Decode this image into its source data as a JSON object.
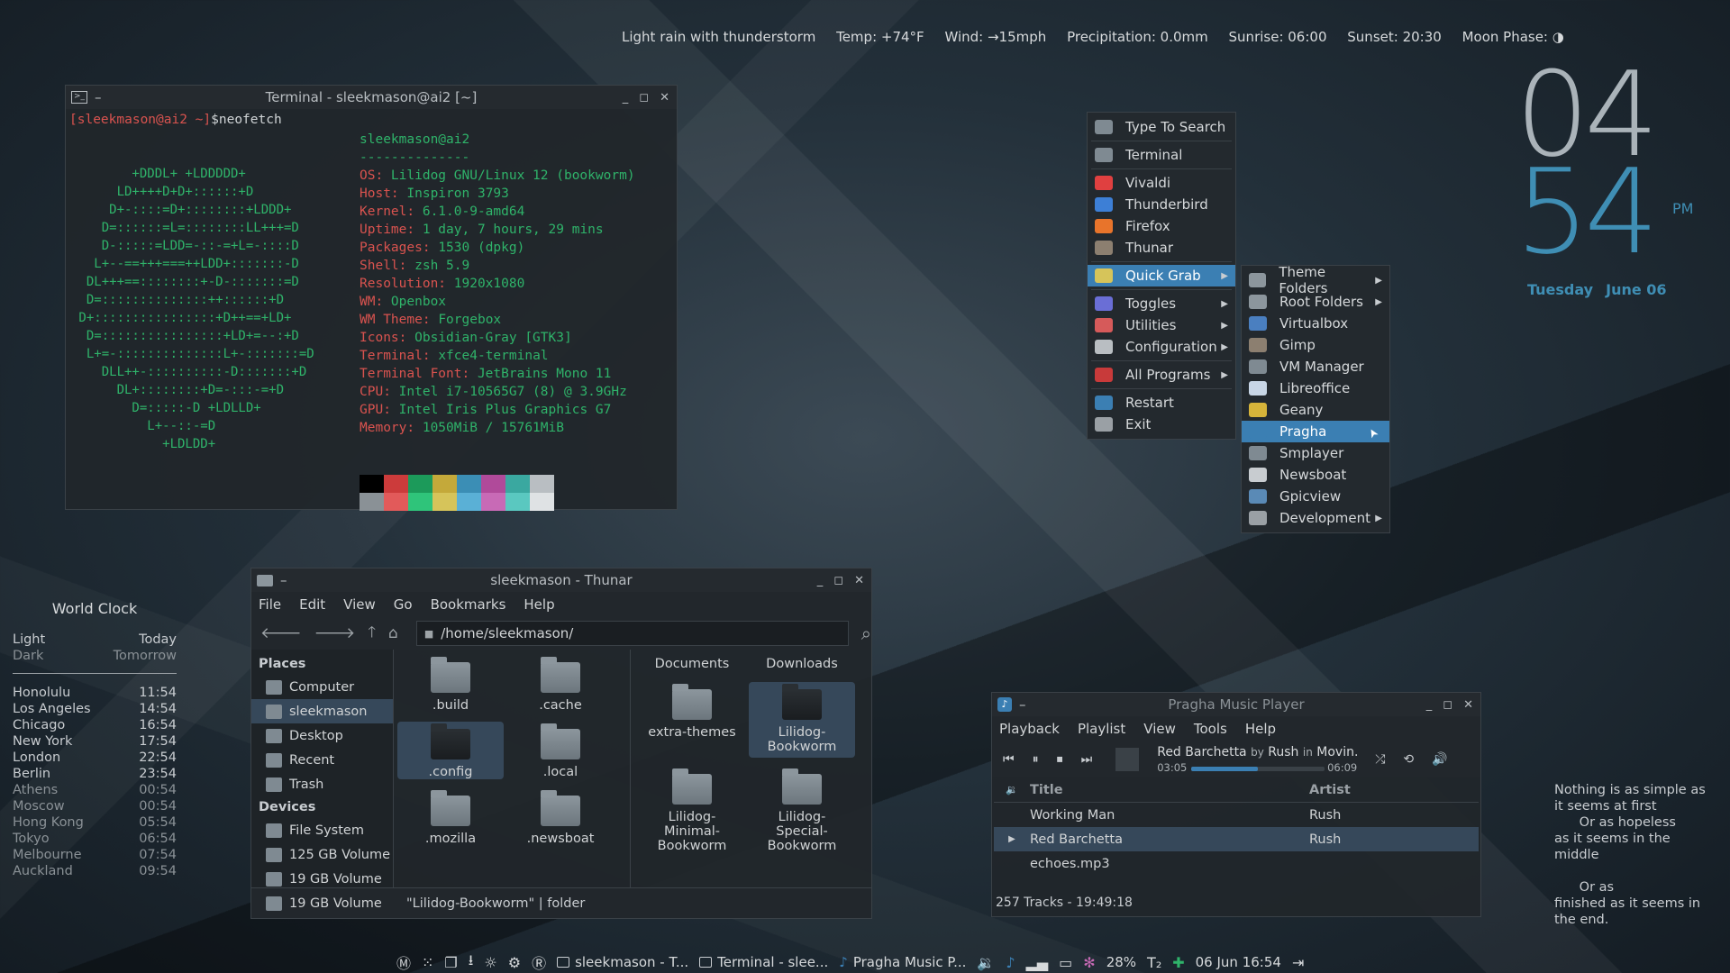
{
  "weather": {
    "condition": "Light rain with thunderstorm",
    "temp": "Temp: +74°F",
    "wind": "Wind: →15mph",
    "precip": "Precipitation: 0.0mm",
    "sunrise": "Sunrise: 06:00",
    "sunset": "Sunset: 20:30",
    "moon": "Moon Phase: ◑"
  },
  "clock": {
    "hour": "04",
    "minute": "54",
    "ampm": "PM",
    "day": "Tuesday",
    "date": "June 06"
  },
  "terminal": {
    "title": "Terminal - sleekmason@ai2 [~]",
    "prompt": "[sleekmason@ai2 ~]",
    "command": "$neofetch",
    "ascii": "        +DDDL+ +LDDDDD+\n      LD++++D+D+::::::+D\n     D+-::::=D+::::::::+LDDD+\n    D=::::::=L=::::::::LL+++=D\n    D-:::::=LDD=-::-=+L=-::::D\n   L+--==+++===++LDD+:::::::-D\n  DL+++==::::::::+-D-:::::::=D\n  D=::::::::::::::++::::::+D\n D+::::::::::::::::+D++==+LD+\n  D=::::::::::::::::+LD+=--:+D\n  L+=-::::::::::::::L+-:::::::=D\n    DLL++-::::::::::-D:::::::+D\n      DL+::::::::+D=-:::-=+D\n        D=:::::-D +LDLLD+\n          L+--::-=D\n            +LDLDD+",
    "header": "sleekmason@ai2",
    "dashes": "--------------",
    "info": [
      {
        "k": "OS: ",
        "v": "Lilidog GNU/Linux 12 (bookworm)"
      },
      {
        "k": "Host: ",
        "v": "Inspiron 3793"
      },
      {
        "k": "Kernel: ",
        "v": "6.1.0-9-amd64"
      },
      {
        "k": "Uptime: ",
        "v": "1 day, 7 hours, 29 mins"
      },
      {
        "k": "Packages: ",
        "v": "1530 (dpkg)"
      },
      {
        "k": "Shell: ",
        "v": "zsh 5.9"
      },
      {
        "k": "Resolution: ",
        "v": "1920x1080"
      },
      {
        "k": "WM: ",
        "v": "Openbox"
      },
      {
        "k": "WM Theme: ",
        "v": "Forgebox"
      },
      {
        "k": "Icons: ",
        "v": "Obsidian-Gray [GTK3]"
      },
      {
        "k": "Terminal: ",
        "v": "xfce4-terminal"
      },
      {
        "k": "Terminal Font: ",
        "v": "JetBrains Mono 11"
      },
      {
        "k": "CPU: ",
        "v": "Intel i7-10565G7 (8) @ 3.9GHz"
      },
      {
        "k": "GPU: ",
        "v": "Intel Iris Plus Graphics G7"
      },
      {
        "k": "Memory: ",
        "v": "1050MiB / 15761MiB"
      }
    ],
    "palette": [
      "#000000",
      "#cc3b3b",
      "#1c9a5a",
      "#c4a93a",
      "#3b8eb5",
      "#b04a9a",
      "#3aa8a0",
      "#b9bec2",
      "#8a9196",
      "#e25a5a",
      "#2fc47a",
      "#d6c45a",
      "#5ab0d6",
      "#c86ab6",
      "#5ac8c0",
      "#dfe2e4"
    ]
  },
  "main_menu": [
    {
      "label": "Type To Search",
      "icon": "keyboard-icon",
      "color": "#7f8a92"
    },
    {
      "sep": true
    },
    {
      "label": "Terminal",
      "icon": "terminal-icon",
      "color": "#7f8a92"
    },
    {
      "sep": true
    },
    {
      "label": "Vivaldi",
      "icon": "vivaldi-icon",
      "color": "#e04040"
    },
    {
      "label": "Thunderbird",
      "icon": "thunderbird-icon",
      "color": "#3d7fd6"
    },
    {
      "label": "Firefox",
      "icon": "firefox-icon",
      "color": "#e8742b"
    },
    {
      "label": "Thunar",
      "icon": "thunar-icon",
      "color": "#8c7f70"
    },
    {
      "sep": true
    },
    {
      "label": "Quick Grab",
      "icon": "quick-grab-icon",
      "color": "#d6c45a",
      "submenu": true,
      "selected": true
    },
    {
      "sep": true
    },
    {
      "label": "Toggles",
      "icon": "toggles-icon",
      "color": "#6a6ed6",
      "submenu": true
    },
    {
      "label": "Utilities",
      "icon": "utilities-icon",
      "color": "#d65a5a",
      "submenu": true
    },
    {
      "label": "Configuration",
      "icon": "configuration-icon",
      "color": "#b9bec2",
      "submenu": true
    },
    {
      "sep": true
    },
    {
      "label": "All Programs",
      "icon": "all-programs-icon",
      "color": "#c83a3a",
      "submenu": true
    },
    {
      "sep": true
    },
    {
      "label": "Restart",
      "icon": "restart-icon",
      "color": "#3b7fb3"
    },
    {
      "label": "Exit",
      "icon": "exit-icon",
      "color": "#9aa0a5"
    }
  ],
  "sub_menu": [
    {
      "label": "Theme Folders",
      "icon": "folder-icon",
      "color": "#8c969d",
      "submenu": true
    },
    {
      "label": "Root Folders",
      "icon": "folder-icon",
      "color": "#8c969d",
      "submenu": true
    },
    {
      "label": "Virtualbox",
      "icon": "virtualbox-icon",
      "color": "#4a7fc0"
    },
    {
      "label": "Gimp",
      "icon": "gimp-icon",
      "color": "#8c7f70"
    },
    {
      "label": "VM Manager",
      "icon": "vm-manager-icon",
      "color": "#7f8a92"
    },
    {
      "label": "Libreoffice",
      "icon": "libreoffice-icon",
      "color": "#c8d6e6"
    },
    {
      "label": "Geany",
      "icon": "geany-icon",
      "color": "#d6b43a"
    },
    {
      "label": "Pragha",
      "icon": "pragha-icon",
      "color": "#3b7fb3",
      "selected": true
    },
    {
      "label": "Smplayer",
      "icon": "smplayer-icon",
      "color": "#7f8a92"
    },
    {
      "label": "Newsboat",
      "icon": "newsboat-icon",
      "color": "#c8ccd0"
    },
    {
      "label": "Gpicview",
      "icon": "gpicview-icon",
      "color": "#5a8ab6"
    },
    {
      "label": "Development",
      "icon": "development-icon",
      "color": "#9aa0a5",
      "submenu": true
    }
  ],
  "thunar": {
    "title": "sleekmason - Thunar",
    "menus": [
      "File",
      "Edit",
      "View",
      "Go",
      "Bookmarks",
      "Help"
    ],
    "path": "/home/sleekmason/",
    "places_title": "Places",
    "places": [
      "Computer",
      "sleekmason",
      "Desktop",
      "Recent",
      "Trash"
    ],
    "devices_title": "Devices",
    "devices": [
      "File System",
      "125 GB Volume",
      "19 GB Volume",
      "19 GB Volume"
    ],
    "files_left": [
      ".build",
      ".cache",
      ".config",
      ".local",
      ".mozilla",
      ".newsboat"
    ],
    "files_right_top": [
      "Documents",
      "Downloads"
    ],
    "files_right": [
      "extra-themes",
      "Lilidog-Bookworm",
      "Lilidog-Minimal-Bookworm",
      "Lilidog-Special-Bookworm"
    ],
    "status": "\"Lilidog-Bookworm\"  |  folder"
  },
  "pragha": {
    "title": "Pragha Music Player",
    "menus": [
      "Playback",
      "Playlist",
      "View",
      "Tools",
      "Help"
    ],
    "now_playing": "Red Barchetta",
    "by_label": "by",
    "now_artist": "Rush",
    "in_label": "in",
    "now_album": "Movin...",
    "elapsed": "03:05",
    "total": "06:09",
    "progress": 0.5,
    "col_title": "Title",
    "col_artist": "Artist",
    "tracks": [
      {
        "title": "Working Man",
        "artist": "Rush"
      },
      {
        "title": "Red Barchetta",
        "artist": "Rush",
        "playing": true
      },
      {
        "title": "echoes.mp3",
        "artist": ""
      }
    ],
    "status": "257 Tracks - 19:49:18"
  },
  "world_clock": {
    "title": "World Clock",
    "legend": [
      {
        "a": "Light",
        "b": "Today"
      },
      {
        "a": "Dark",
        "b": "Tomorrow"
      }
    ],
    "cities": [
      {
        "city": "Honolulu",
        "time": "11:54"
      },
      {
        "city": "Los Angeles",
        "time": "14:54"
      },
      {
        "city": "Chicago",
        "time": "16:54"
      },
      {
        "city": "New York",
        "time": "17:54"
      },
      {
        "city": "London",
        "time": "22:54"
      },
      {
        "city": "Berlin",
        "time": "23:54"
      },
      {
        "city": "Athens",
        "time": "00:54",
        "dark": true
      },
      {
        "city": "Moscow",
        "time": "00:54",
        "dark": true
      },
      {
        "city": "Hong Kong",
        "time": "05:54",
        "dark": true
      },
      {
        "city": "Tokyo",
        "time": "06:54",
        "dark": true
      },
      {
        "city": "Melbourne",
        "time": "07:54",
        "dark": true
      },
      {
        "city": "Auckland",
        "time": "09:54",
        "dark": true
      }
    ]
  },
  "quote": [
    "Nothing is as simple as",
    "it seems at first",
    "      Or as hopeless",
    "as it seems in the",
    "middle",
    "",
    "      Or as",
    "finished as it seems in",
    "the end."
  ],
  "taskbar": {
    "tasks": [
      "sleekmason - T...",
      "Terminal - slee...",
      "Pragha Music P..."
    ],
    "battery": "28%",
    "datetime": "06 Jun 16:54"
  }
}
